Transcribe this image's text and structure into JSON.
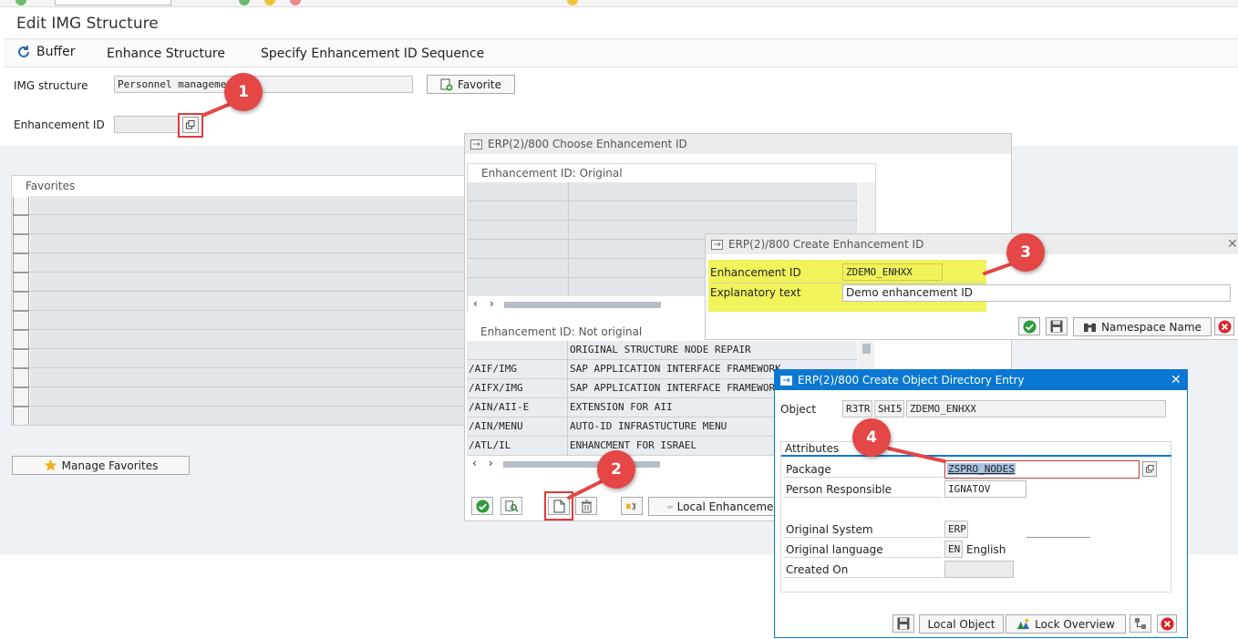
{
  "window": {
    "title": "Edit IMG Structure"
  },
  "menu": {
    "buffer": "Buffer",
    "enhance_structure": "Enhance Structure",
    "specify_seq": "Specify Enhancement ID Sequence"
  },
  "main": {
    "img_structure_label": "IMG structure",
    "img_structure_value": "Personnel managemen",
    "favorite_button": "Favorite",
    "enhancement_id_label": "Enhancement ID",
    "enhancement_id_value": "",
    "favorites_header": "Favorites",
    "manage_favorites": "Manage Favorites"
  },
  "choose_dialog": {
    "title": "ERP(2)/800 Choose Enhancement ID",
    "original_header": "Enhancement ID: Original",
    "not_original_header": "Enhancement ID: Not original",
    "rows": [
      {
        "id": "",
        "text": "ORIGINAL STRUCTURE NODE REPAIR"
      },
      {
        "id": "/AIF/IMG",
        "text": "SAP APPLICATION INTERFACE FRAMEWORK"
      },
      {
        "id": "/AIFX/IMG",
        "text": "SAP APPLICATION INTERFACE FRAMEWORK"
      },
      {
        "id": "/AIN/AII-E",
        "text": "EXTENSION FOR AII"
      },
      {
        "id": "/AIN/MENU",
        "text": "AUTO-ID INFRASTUCTURE MENU"
      },
      {
        "id": "/ATL/IL",
        "text": "ENHANCMENT FOR ISRAEL"
      }
    ],
    "local_button": "Local Enhancemen"
  },
  "create_enh_dialog": {
    "title": "ERP(2)/800 Create Enhancement ID",
    "id_label": "Enhancement ID",
    "id_value": "ZDEMO_ENHXX",
    "text_label": "Explanatory text",
    "text_value": "Demo enhancement ID",
    "namespace_button": "Namespace Name"
  },
  "obj_dir_dialog": {
    "title": "ERP(2)/800 Create Object Directory Entry",
    "object_label": "Object",
    "object_pgmid": "R3TR",
    "object_type": "SHI5",
    "object_name": "ZDEMO_ENHXX",
    "attributes_header": "Attributes",
    "package_label": "Package",
    "package_value": "ZSPRO_NODES",
    "person_label": "Person Responsible",
    "person_value": "IGNATOV",
    "orig_system_label": "Original System",
    "orig_system_value": "ERP",
    "orig_lang_label": "Original language",
    "orig_lang_code": "EN",
    "orig_lang_name": "English",
    "created_on_label": "Created On",
    "local_object_button": "Local Object",
    "lock_overview_button": "Lock Overview"
  },
  "callouts": {
    "c1": "1",
    "c2": "2",
    "c3": "3",
    "c4": "4"
  },
  "colors": {
    "highlight": "#f0f35a",
    "callout": "#e54646",
    "blue_title": "#0a78d2",
    "ok_green": "#2e9b3e",
    "cancel_red": "#d9262c"
  }
}
